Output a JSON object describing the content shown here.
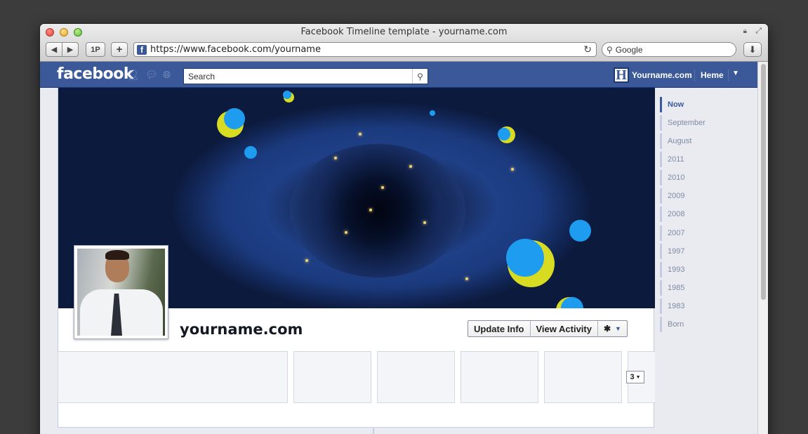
{
  "browser": {
    "title": "Facebook Timeline template - yourname.com",
    "url": "https://www.facebook.com/yourname",
    "onepassword_label": "1P",
    "add_label": "+",
    "search_placeholder": "Google"
  },
  "facebook": {
    "logo": "facebook",
    "search_placeholder": "Search",
    "user_name": "Yourname.com",
    "home_label": "Heme",
    "brand_letter": "H",
    "page_name": "yourname.com",
    "update_info_label": "Update Info",
    "view_activity_label": "View Activity",
    "count_label": "3",
    "colors": {
      "bar": "#3b5998",
      "accent_yellow": "#d7dc22",
      "accent_blue": "#1e9cf0"
    }
  },
  "scrubber": {
    "items": [
      "Now",
      "September",
      "August",
      "2011",
      "2010",
      "2009",
      "2008",
      "2007",
      "1997",
      "1993",
      "1985",
      "1983",
      "Born"
    ]
  }
}
